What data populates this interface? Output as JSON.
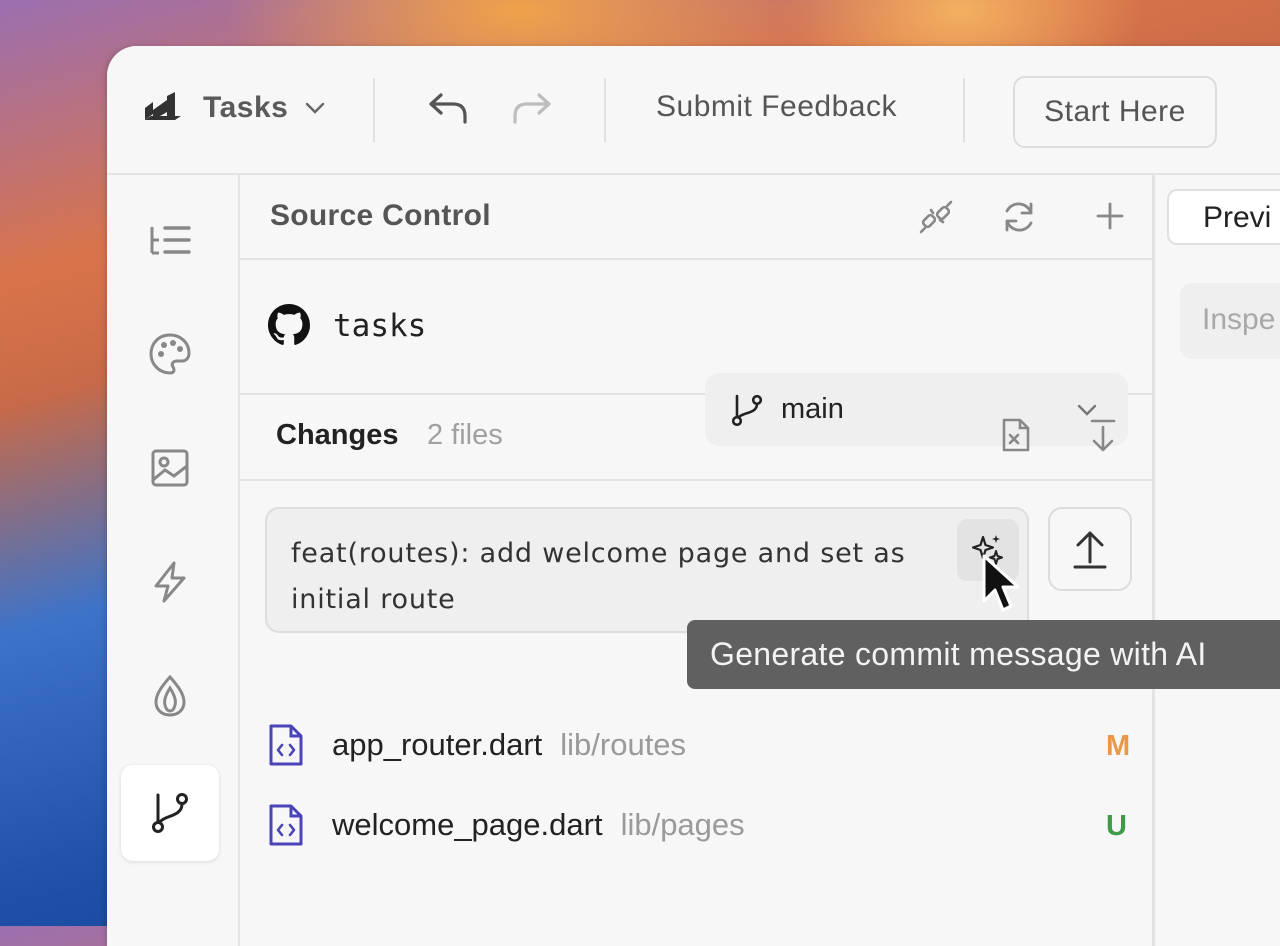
{
  "toolbar": {
    "app_name": "Tasks",
    "submit_feedback": "Submit Feedback",
    "start_here": "Start Here"
  },
  "sidebar": {
    "items": [
      {
        "icon": "outline-icon"
      },
      {
        "icon": "palette-icon"
      },
      {
        "icon": "image-icon"
      },
      {
        "icon": "sparkle-logo-icon"
      },
      {
        "icon": "firebase-icon"
      },
      {
        "icon": "git-branch-icon",
        "active": true
      }
    ]
  },
  "source_control": {
    "title": "Source Control",
    "repo_name": "tasks",
    "branch": "main",
    "changes_label": "Changes",
    "changes_count": "2 files",
    "commit_message": "feat(routes): add welcome page and set as initial route",
    "files": [
      {
        "name": "app_router.dart",
        "path": "lib/routes",
        "status": "M",
        "status_color": "#e8984a"
      },
      {
        "name": "welcome_page.dart",
        "path": "lib/pages",
        "status": "U",
        "status_color": "#3f9a4a"
      }
    ]
  },
  "right_pane": {
    "tab": "Previ",
    "input_placeholder": "Inspe"
  },
  "tooltip": {
    "text": "Generate commit message with AI"
  },
  "colors": {
    "file_icon": "#4a44b8",
    "text_primary": "#1f1f1f",
    "text_muted": "#9a9a9a"
  }
}
